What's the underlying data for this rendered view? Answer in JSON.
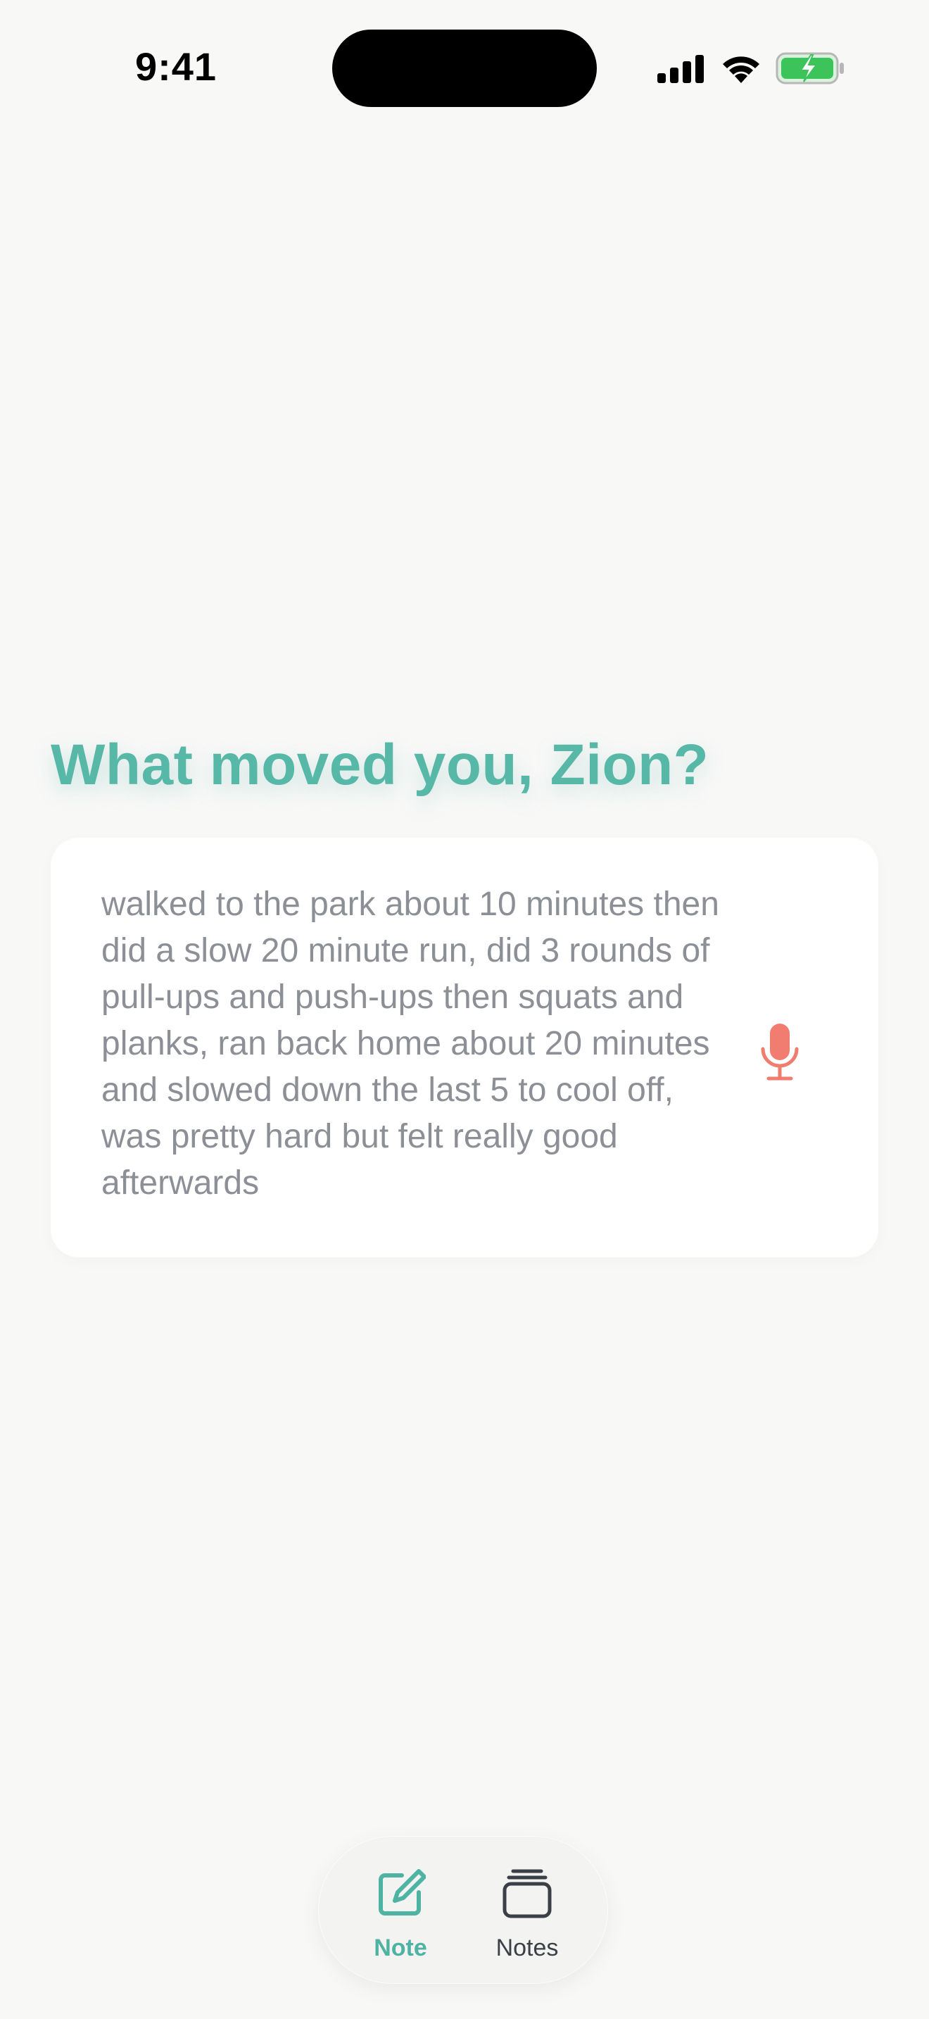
{
  "status_bar": {
    "time": "9:41",
    "icons": [
      "cellular-signal-icon",
      "wifi-icon",
      "battery-charging-icon"
    ]
  },
  "prompt": {
    "heading": "What moved you, Zion?"
  },
  "entry": {
    "text": "walked to the park about 10 minutes then did a slow 20 minute run, did 3 rounds of pull-ups and push-ups then squats and planks, ran back home about 20 minutes and slowed down the last 5 to cool off, was pretty hard but felt really good afterwards",
    "mic_icon": "microphone-icon"
  },
  "tabbar": {
    "tabs": [
      {
        "label": "Note",
        "icon": "compose-icon",
        "selected": true
      },
      {
        "label": "Notes",
        "icon": "stack-icon",
        "selected": false
      }
    ]
  },
  "colors": {
    "accent": "#58b8a8",
    "mic": "#f07d6f",
    "battery": "#3cc45a",
    "background": "#f8f8f7"
  }
}
